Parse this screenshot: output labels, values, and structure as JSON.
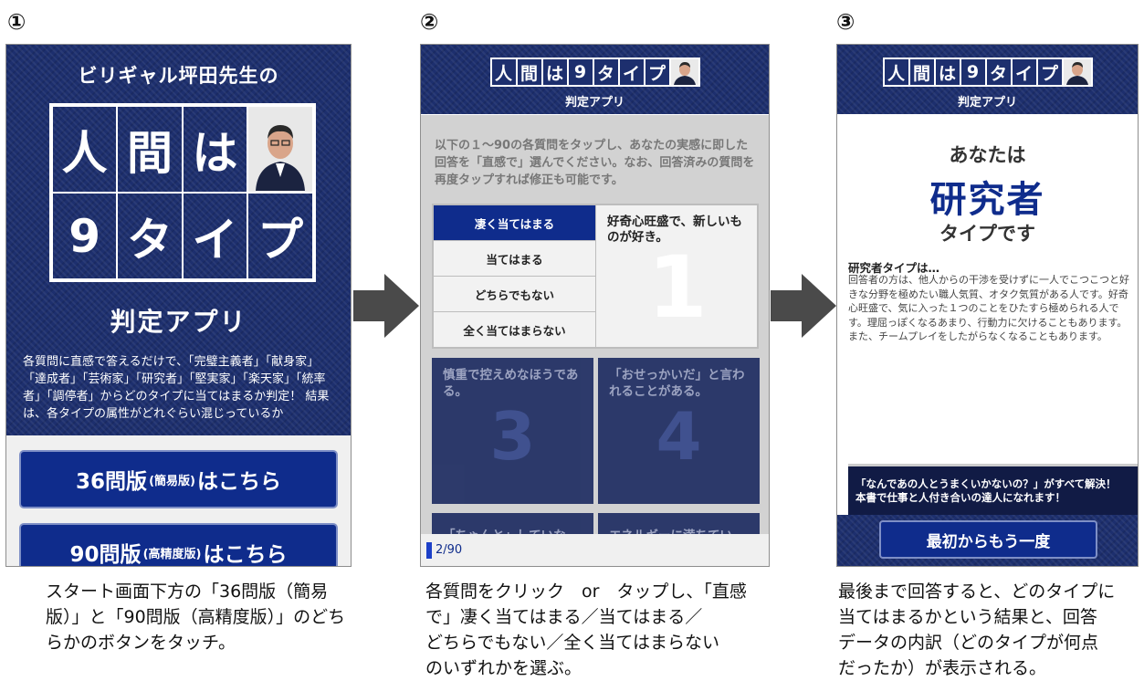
{
  "steps": [
    {
      "num": "①",
      "caption": [
        "スタート画面下方の「36問版（簡易",
        "版）」と「90問版（高精度版）」のどち",
        "らかのボタンをタッチ。"
      ]
    },
    {
      "num": "②",
      "caption": [
        "各質問をクリック　or　タップし、「直感",
        "で」凄く当てはまる／当てはまる／",
        "どちらでもない／全く当てはまらない",
        "のいずれかを選ぶ。"
      ]
    },
    {
      "num": "③",
      "caption": [
        "最後まで回答すると、どのタイプに",
        "当てはまるかという結果と、回答",
        "データの内訳（どのタイプが何点",
        "だったか）が表示される。"
      ]
    }
  ],
  "screen1": {
    "subtitle": "ビリギャル坪田先生の",
    "title_chars": [
      "人",
      "間",
      "は",
      "9",
      "タ",
      "イ",
      "プ"
    ],
    "app_label": "判定アプリ",
    "description": "各質問に直感で答えるだけで、「完璧主義者」「献身家」「達成者」「芸術家」「研究者」「堅実家」「楽天家」「統率者」「調停者」からどのタイプに当てはまるか判定！ 結果は、各タイプの属性がどれぐらい混じっているか",
    "btn36": {
      "main": "36問版",
      "sub": "(簡易版)",
      "tail": "はこちら"
    },
    "btn90": {
      "main": "90問版",
      "sub": "(高精度版)",
      "tail": "はこちら"
    }
  },
  "header": {
    "logo_chars": [
      "人",
      "間",
      "は",
      "9",
      "タ",
      "イ",
      "プ"
    ],
    "sub": "判定アプリ"
  },
  "screen2": {
    "intro": "以下の１～90の各質問をタップし、あなたの実感に即した回答を「直感で」選んでください。なお、回答済みの質問を再度タップすれば修正も可能です。",
    "options": [
      "凄く当てはまる",
      "当てはまる",
      "どちらでもない",
      "全く当てはまらない"
    ],
    "selected_option": 0,
    "question_text": "好奇心旺盛で、新しいものが好き。",
    "question_number": "1",
    "cards": [
      {
        "text": "慎重で控えめなほうである。",
        "num": "3"
      },
      {
        "text": "「おせっかいだ」と言われることがある。",
        "num": "4"
      },
      {
        "text": "「ちゃんと」していな",
        "num": ""
      },
      {
        "text": "エネルギーに満ちてい",
        "num": ""
      }
    ],
    "progress": "2/90",
    "progress_fraction": 0.022
  },
  "screen3": {
    "line1": "あなたは",
    "type": "研究者",
    "line2": "タイプです",
    "heading": "研究者タイプは…",
    "desc": "回答者の方は、他人からの干渉を受けずに一人でこつこつと好きな分野を極めたい職人気質、オタク気質がある人です。好奇心旺盛で、気に入った１つのことをひたすら極められる人です。理屈っぽくなるあまり、行動力に欠けることもあります。また、チームプレイをしたがらなくなることもあります。",
    "ad": "「なんであの人とうまくいかないの？」がすべて解決！\n本書で仕事と人付き合いの達人になれます！",
    "restart": "最初からもう一度"
  },
  "colors": {
    "denim": "#1d2f6e",
    "button": "#0f2c8c",
    "arrow": "#4a4a4a"
  }
}
